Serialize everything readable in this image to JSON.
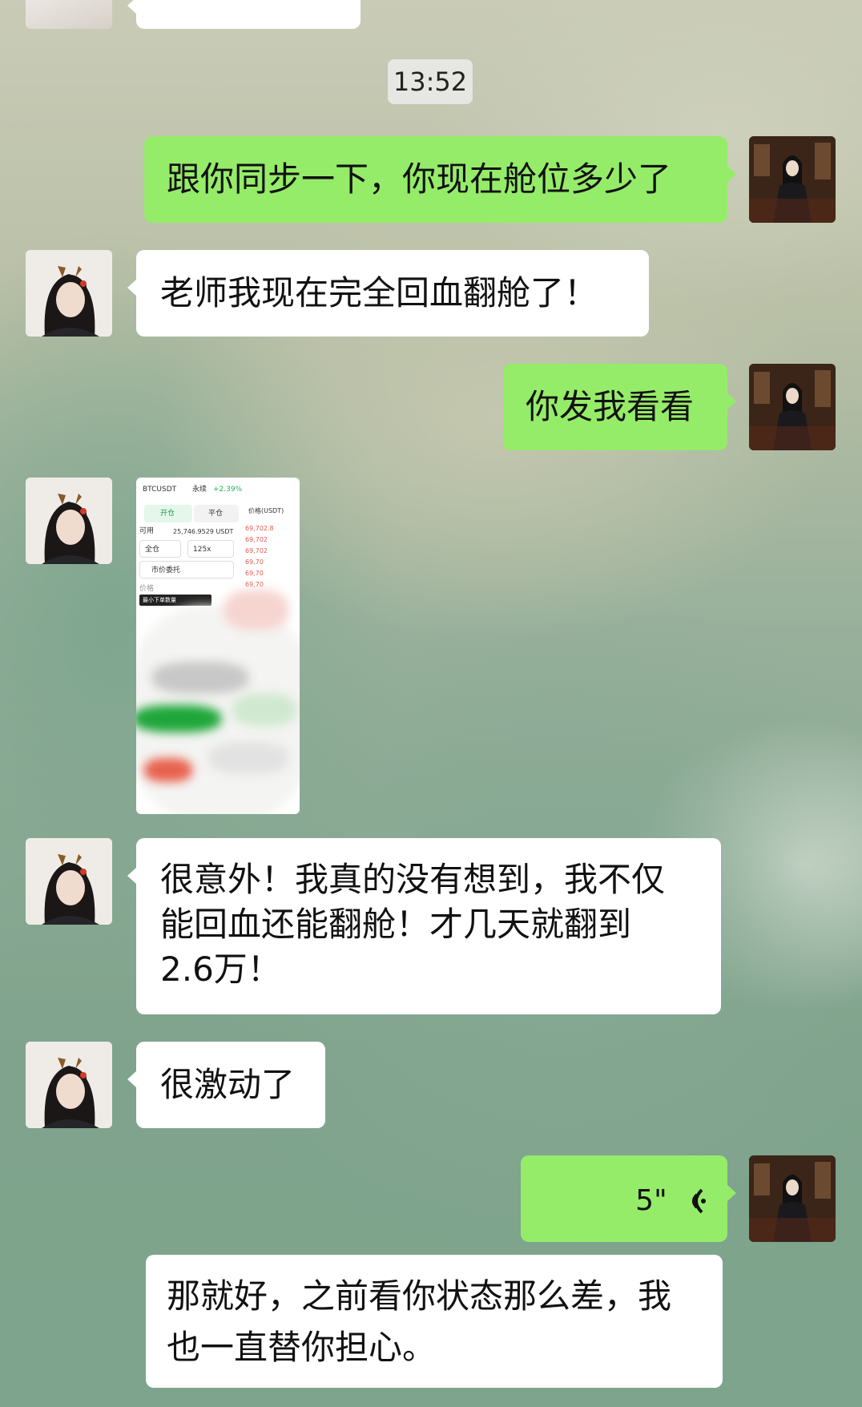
{
  "timestamp": "13:52",
  "messages": [
    {
      "side": "right",
      "type": "text",
      "text": "跟你同步一下，你现在舱位多少了"
    },
    {
      "side": "left",
      "type": "text",
      "text": "老师我现在完全回血翻舱了！"
    },
    {
      "side": "right",
      "type": "text",
      "text": "你发我看看"
    },
    {
      "side": "left",
      "type": "image"
    },
    {
      "side": "left",
      "type": "text",
      "lines": [
        "很意外！我真的没有想到，我不仅",
        "能回血还能翻舱！才几天就翻到",
        "2.6万！"
      ]
    },
    {
      "side": "left",
      "type": "text",
      "text": "很激动了"
    },
    {
      "side": "right",
      "type": "voice",
      "duration": "5\""
    },
    {
      "side": "right",
      "type": "text",
      "lines": [
        "那就好，之前看你状态那么差，我",
        "也一直替你担心。"
      ]
    }
  ],
  "screenshot": {
    "pair": "BTCUSDT",
    "contract": "永续",
    "change": "+2.39%",
    "tab_open": "开仓",
    "tab_close": "平仓",
    "available_label": "可用",
    "available": "25,746.9529 USDT",
    "margin_mode": "全仓",
    "leverage": "125x",
    "order_type": "市价委托",
    "price_label": "价格",
    "price_input": "最小下单数量",
    "col_header": "价格(USDT)",
    "prices": [
      "69,702.8",
      "69,702",
      "69,702",
      "69,70",
      "69,70",
      "69,70"
    ]
  },
  "colors": {
    "bubble_self": "#95ec69",
    "bubble_other": "#ffffff",
    "timestamp_bg": "#e6e6e3"
  }
}
